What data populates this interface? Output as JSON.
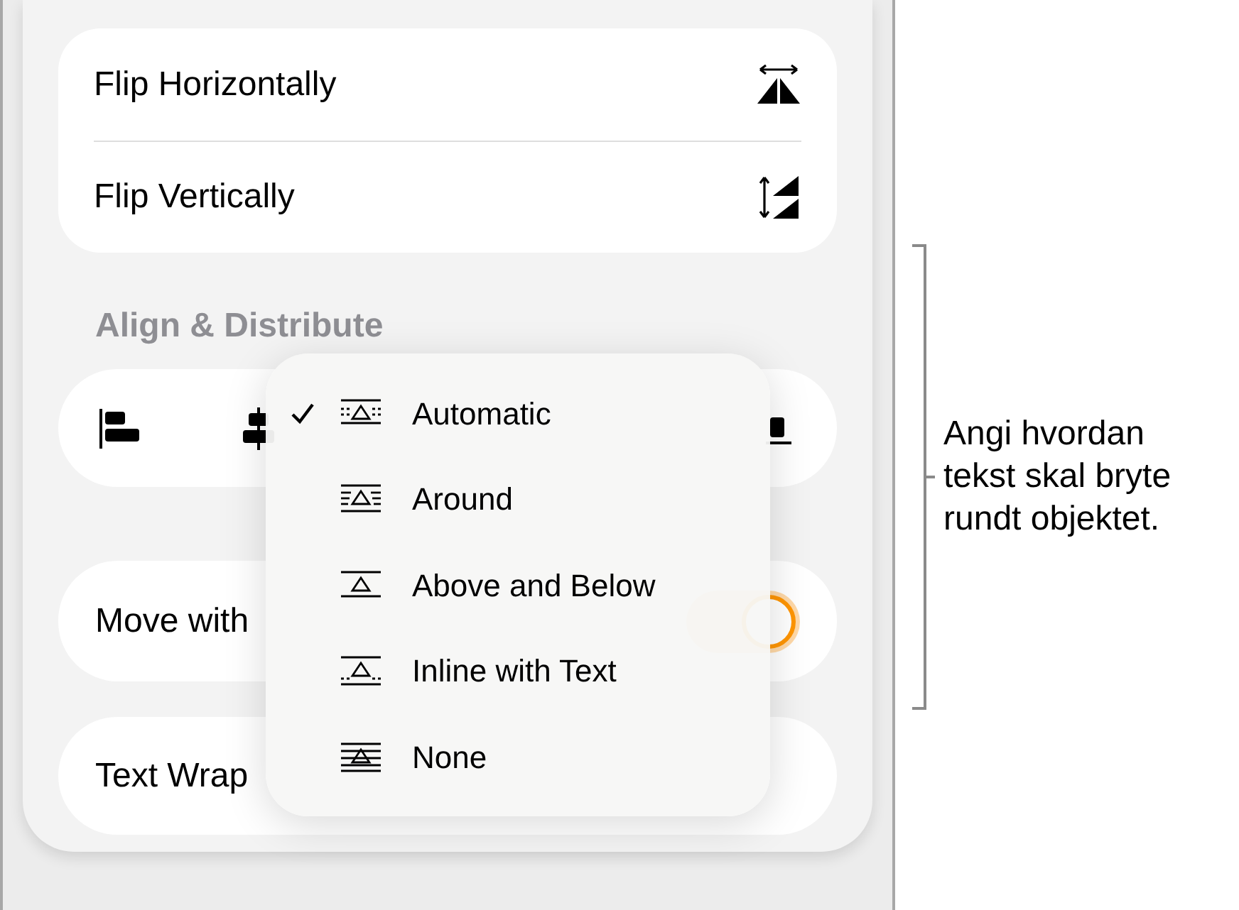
{
  "flip": [
    {
      "label": "Flip Horizontally",
      "kind": "horizontal"
    },
    {
      "label": "Flip Vertically",
      "kind": "vertical"
    }
  ],
  "align_heading": "Align & Distribute",
  "align_buttons": [
    {
      "kind": "left"
    },
    {
      "kind": "center"
    },
    {
      "kind": "bottom"
    }
  ],
  "move_with_text": {
    "label": "Move with",
    "on": true
  },
  "text_wrap": {
    "label": "Text Wrap"
  },
  "wrap_menu": [
    {
      "label": "Automatic",
      "kind": "automatic",
      "selected": true
    },
    {
      "label": "Around",
      "kind": "around",
      "selected": false
    },
    {
      "label": "Above and Below",
      "kind": "above_below",
      "selected": false
    },
    {
      "label": "Inline with Text",
      "kind": "inline",
      "selected": false
    },
    {
      "label": "None",
      "kind": "none",
      "selected": false
    }
  ],
  "callout": "Angi hvordan tekst skal bryte rundt objektet."
}
